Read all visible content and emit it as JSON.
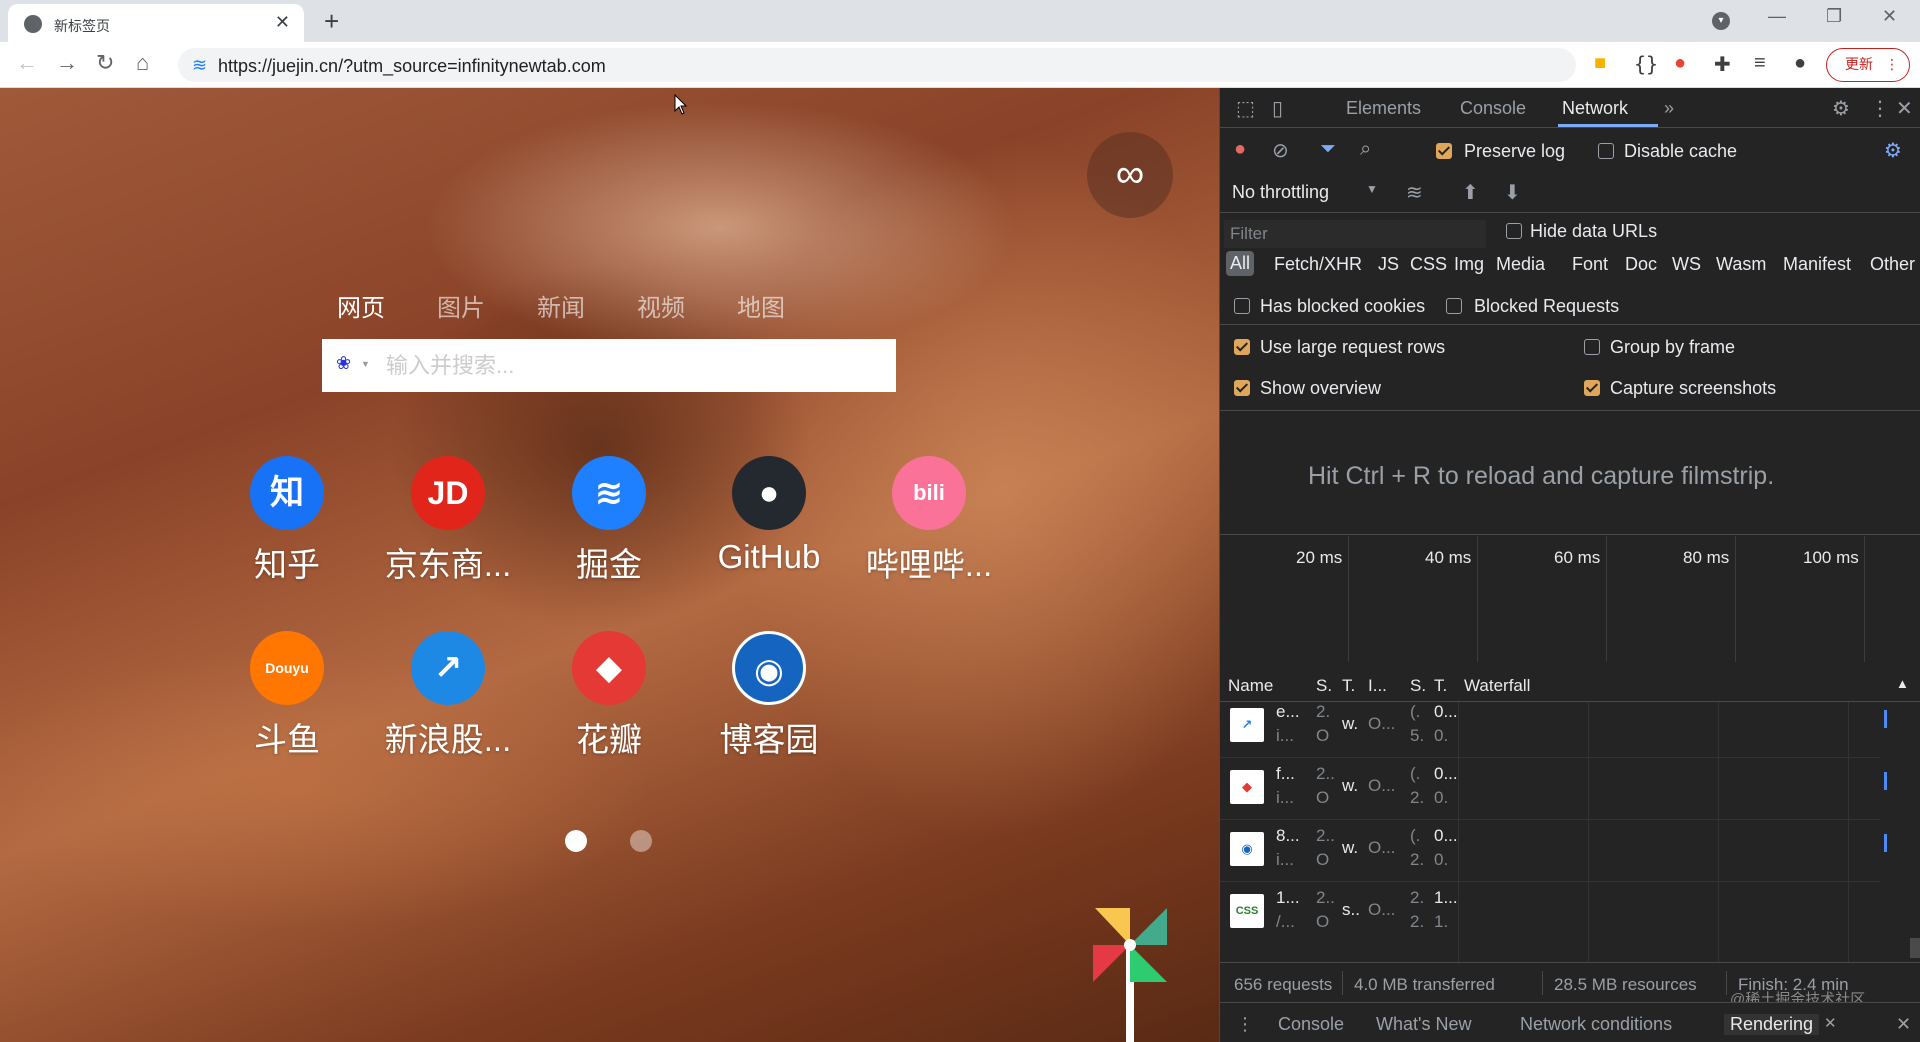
{
  "browser": {
    "tab_title": "新标签页",
    "tab_close": "✕",
    "new_tab": "+",
    "url": "https://juejin.cn/?utm_source=infinitynewtab.com",
    "update_label": "更新",
    "nav": {
      "back": "←",
      "forward": "→",
      "reload": "↻",
      "home": "⌂"
    },
    "window": {
      "minimize": "—",
      "restore": "❐",
      "close": "✕"
    }
  },
  "newtab": {
    "search_tabs": [
      "网页",
      "图片",
      "新闻",
      "视频",
      "地图"
    ],
    "active_search_tab": "网页",
    "search_placeholder": "输入并搜索...",
    "sites": [
      {
        "name": "知乎",
        "icon": "知",
        "color": "#1772f6"
      },
      {
        "name": "京东商...",
        "icon": "JD",
        "color": "#e1251b"
      },
      {
        "name": "掘金",
        "icon": "≋",
        "color": "#1e80ff"
      },
      {
        "name": "GitHub",
        "icon": "●",
        "color": "#24292f"
      },
      {
        "name": "哔哩哔...",
        "icon": "bili",
        "color": "#fb7299"
      },
      {
        "name": "斗鱼",
        "icon": "Douyu",
        "color": "#ff7700"
      },
      {
        "name": "新浪股...",
        "icon": "↗",
        "color": "#1e88e5"
      },
      {
        "name": "花瓣",
        "icon": "◆",
        "color": "#e53935"
      },
      {
        "name": "博客园",
        "icon": "◉",
        "color": "#1565c0"
      }
    ],
    "page_dots": 2,
    "active_page": 1
  },
  "devtools": {
    "tabs": [
      "Elements",
      "Console",
      "Network"
    ],
    "active_tab": "Network",
    "more_tabs": "»",
    "preserve_log": "Preserve log",
    "disable_cache": "Disable cache",
    "throttling": "No throttling",
    "filter_placeholder": "Filter",
    "hide_data_urls": "Hide data URLs",
    "types": [
      "All",
      "Fetch/XHR",
      "JS",
      "CSS",
      "Img",
      "Media",
      "Font",
      "Doc",
      "WS",
      "Wasm",
      "Manifest",
      "Other"
    ],
    "has_blocked_cookies": "Has blocked cookies",
    "blocked_requests": "Blocked Requests",
    "use_large_rows": "Use large request rows",
    "group_by_frame": "Group by frame",
    "show_overview": "Show overview",
    "capture_screenshots": "Capture screenshots",
    "filmstrip_hint": "Hit Ctrl + R to reload and capture filmstrip.",
    "overview_ticks": [
      "20 ms",
      "40 ms",
      "60 ms",
      "80 ms",
      "100 ms"
    ],
    "columns": [
      "Name",
      "S.",
      "T.",
      "I...",
      "S.",
      "T.",
      "Waterfall"
    ],
    "requests": [
      {
        "thumb": "chart",
        "name": "e...",
        "sub": "i...",
        "s": "2.",
        "s2": "O",
        "t": "w.",
        "i": "O...",
        "size": "(.",
        "size2": "5.",
        "time": "0...",
        "time2": "0."
      },
      {
        "thumb": "red",
        "name": "f...",
        "sub": "i...",
        "s": "2..",
        "s2": "O",
        "t": "w.",
        "i": "O...",
        "size": "(.",
        "size2": "2.",
        "time": "0...",
        "time2": "0."
      },
      {
        "thumb": "rss",
        "name": "8...",
        "sub": "i...",
        "s": "2..",
        "s2": "O",
        "t": "w.",
        "i": "O...",
        "size": "(.",
        "size2": "2.",
        "time": "0...",
        "time2": "0."
      },
      {
        "thumb": "CSS",
        "name": "1...",
        "sub": "/...",
        "s": "2..",
        "s2": "O",
        "t": "s..",
        "i": "O...",
        "size": "2.",
        "size2": "2.",
        "time": "1...",
        "time2": "1."
      }
    ],
    "status": {
      "requests": "656 requests",
      "transferred": "4.0 MB transferred",
      "resources": "28.5 MB resources",
      "finish": "Finish: 2.4 min"
    },
    "drawer_tabs": [
      "Console",
      "What's New",
      "Network conditions",
      "Rendering"
    ],
    "active_drawer_tab": "Rendering",
    "watermark": "@稀土掘金技术社区"
  }
}
